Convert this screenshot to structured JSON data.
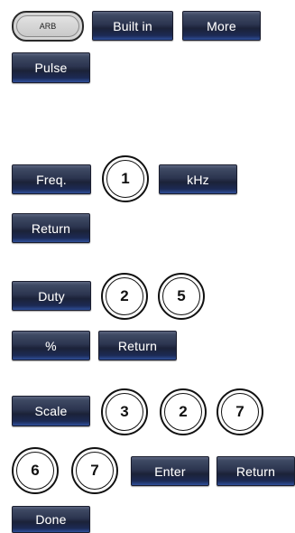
{
  "row1": {
    "arb_label": "ARB",
    "built_in_label": "Built in",
    "more_label": "More"
  },
  "pulse_label": "Pulse",
  "freq_row": {
    "freq_label": "Freq.",
    "digit": "1",
    "unit_label": "kHz"
  },
  "return1_label": "Return",
  "duty_row": {
    "duty_label": "Duty",
    "digits": [
      "2",
      "5"
    ]
  },
  "percent_row": {
    "percent_label": "%",
    "return_label": "Return"
  },
  "scale_row": {
    "scale_label": "Scale",
    "digits": [
      "3",
      "2",
      "7"
    ]
  },
  "enter_row": {
    "digits": [
      "6",
      "7"
    ],
    "enter_label": "Enter",
    "return_label": "Return"
  },
  "done_label": "Done"
}
